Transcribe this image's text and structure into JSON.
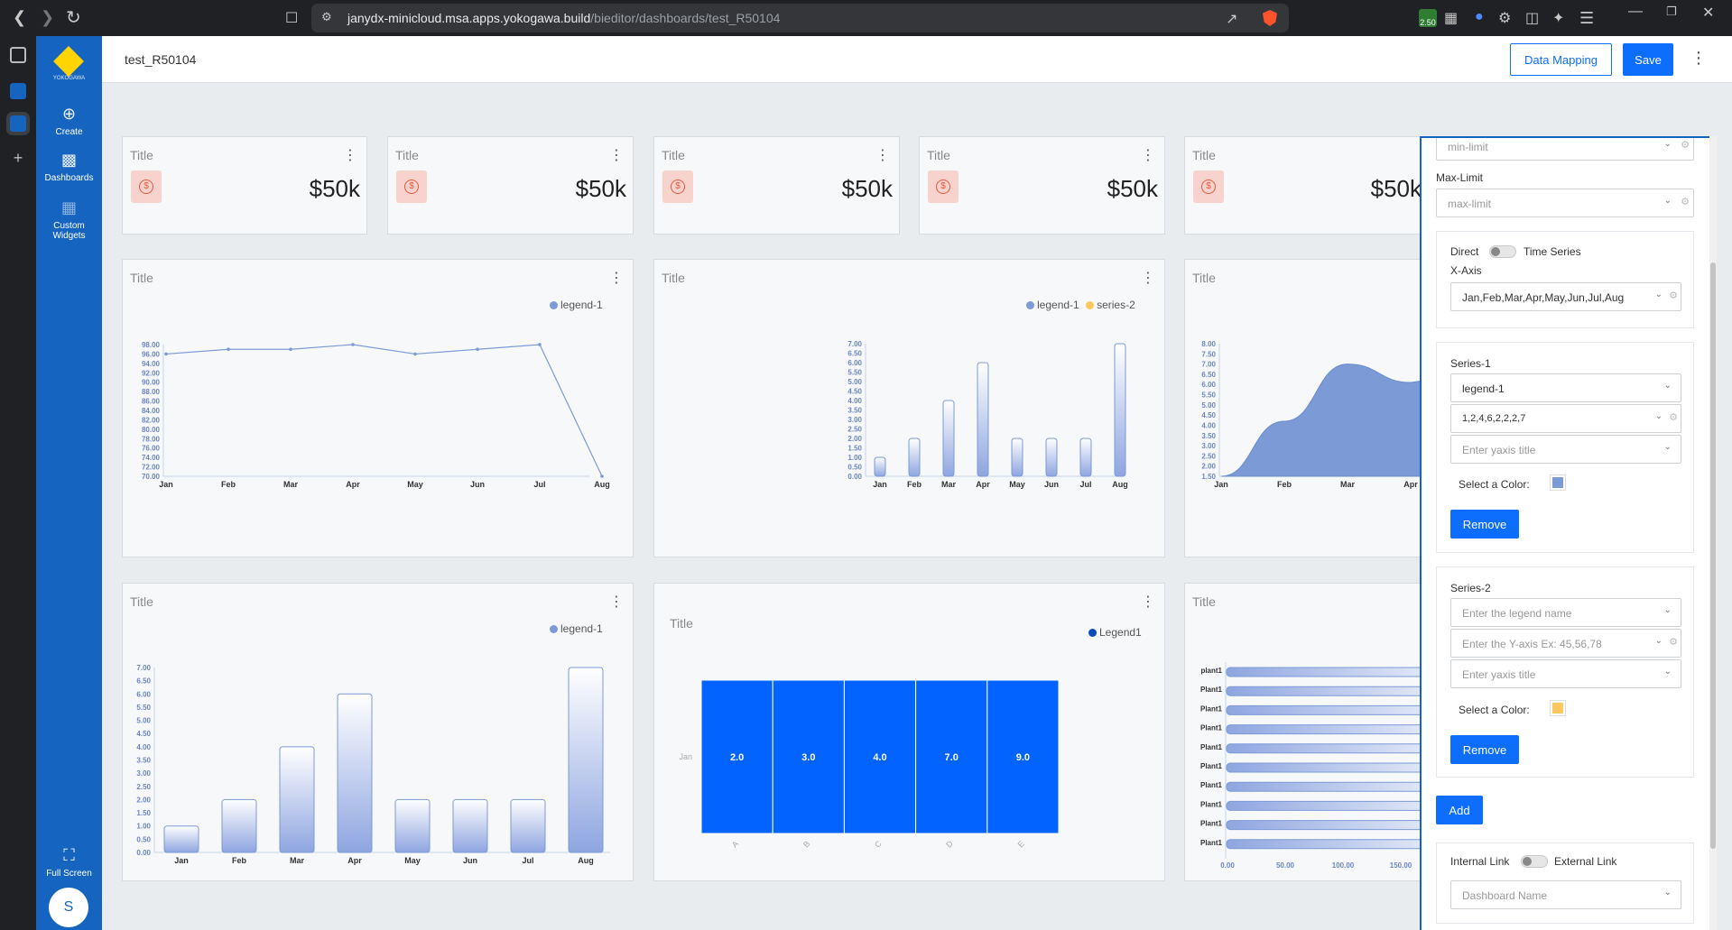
{
  "browser": {
    "url_host": "janydx-minicloud.msa.apps.yokogawa.build",
    "url_path": "/bieditor/dashboards/test_R50104",
    "ext_badge": "2.50"
  },
  "app": {
    "logo_text": "YOKOGAWA",
    "nav": [
      {
        "label": "Create",
        "icon": "plus-circle-icon"
      },
      {
        "label": "Dashboards",
        "icon": "bar-chart-icon"
      },
      {
        "label": "Custom Widgets",
        "icon": "grid-icon"
      }
    ],
    "fullscreen_label": "Full Screen",
    "avatar": "S"
  },
  "header": {
    "title": "test_R50104",
    "data_mapping_label": "Data Mapping",
    "save_label": "Save"
  },
  "kpis": [
    {
      "title": "Title",
      "value": "$50k"
    },
    {
      "title": "Title",
      "value": "$50k"
    },
    {
      "title": "Title",
      "value": "$50k"
    },
    {
      "title": "Title",
      "value": "$50k"
    },
    {
      "title": "Title",
      "value": "$50k"
    }
  ],
  "colors": {
    "accent": "#0d6efd",
    "sidebar": "#1565c0",
    "series1": "#7b9ad6",
    "series2": "#fdc85f",
    "heat": "#0263ff",
    "kpi_icon": "#e05a3f"
  },
  "charts": {
    "line": {
      "title": "Title",
      "legend": "legend-1",
      "chart_data": {
        "type": "line",
        "categories": [
          "Jan",
          "Feb",
          "Mar",
          "Apr",
          "May",
          "Jun",
          "Jul",
          "Aug"
        ],
        "series": [
          {
            "name": "legend-1",
            "values": [
              96,
              97,
              97,
              98,
              96,
              97,
              98,
              70
            ]
          }
        ],
        "ylim": [
          70,
          98
        ],
        "yticks": [
          "70.00",
          "72.00",
          "74.00",
          "76.00",
          "78.00",
          "80.00",
          "82.00",
          "84.00",
          "86.00",
          "88.00",
          "90.00",
          "92.00",
          "94.00",
          "96.00",
          "98.00"
        ]
      }
    },
    "bar": {
      "title": "Title",
      "legend1": "legend-1",
      "legend2": "series-2",
      "chart_data": {
        "type": "bar",
        "categories": [
          "Jan",
          "Feb",
          "Mar",
          "Apr",
          "May",
          "Jun",
          "Jul",
          "Aug"
        ],
        "series": [
          {
            "name": "legend-1",
            "values": [
              1,
              2,
              4,
              6,
              2,
              2,
              2,
              7
            ]
          }
        ],
        "ylim": [
          0,
          7
        ],
        "yticks": [
          "0.00",
          "0.50",
          "1.00",
          "1.50",
          "2.00",
          "2.50",
          "3.00",
          "3.50",
          "4.00",
          "4.50",
          "5.00",
          "5.50",
          "6.00",
          "6.50",
          "7.00"
        ]
      }
    },
    "area": {
      "title": "Title",
      "chart_data": {
        "type": "area",
        "categories": [
          "Jan",
          "Feb",
          "Mar",
          "Apr"
        ],
        "values": [
          1.5,
          4.2,
          7.0,
          6.1
        ],
        "ylim": [
          1.5,
          8
        ],
        "yticks": [
          "1.50",
          "2.00",
          "2.50",
          "3.00",
          "3.50",
          "4.00",
          "4.50",
          "5.00",
          "5.50",
          "6.00",
          "6.50",
          "7.00",
          "7.50",
          "8.00"
        ],
        "xticks": [
          "Jan",
          "Feb",
          "Mar",
          "Apr"
        ]
      }
    },
    "bar2": {
      "title": "Title",
      "legend": "legend-1",
      "chart_data": {
        "type": "bar",
        "categories": [
          "Jan",
          "Feb",
          "Mar",
          "Apr",
          "May",
          "Jun",
          "Jul",
          "Aug"
        ],
        "series": [
          {
            "name": "legend-1",
            "values": [
              1,
              2,
              4,
              6,
              2,
              2,
              2,
              7
            ]
          }
        ],
        "ylim": [
          0,
          7
        ],
        "yticks": [
          "0.00",
          "0.50",
          "1.00",
          "1.50",
          "2.00",
          "2.50",
          "3.00",
          "3.50",
          "4.00",
          "4.50",
          "5.00",
          "5.50",
          "6.00",
          "6.50",
          "7.00"
        ]
      }
    },
    "heatmap": {
      "title": "Title",
      "legend": "Legend1",
      "chart_data": {
        "type": "heatmap",
        "rows": [
          "Jan"
        ],
        "columns": [
          "A",
          "B",
          "C",
          "D",
          "E"
        ],
        "values": [
          [
            2.0,
            3.0,
            4.0,
            7.0,
            9.0
          ]
        ],
        "labels": [
          "2.0",
          "3.0",
          "4.0",
          "7.0",
          "9.0"
        ]
      }
    },
    "hbar": {
      "title": "Title",
      "chart_data": {
        "type": "bar",
        "orientation": "horizontal",
        "categories": [
          "plant1",
          "Plant1",
          "Plant1",
          "Plant1",
          "Plant1",
          "Plant1",
          "Plant1",
          "Plant1",
          "Plant1",
          "Plant1"
        ],
        "xticks": [
          "0.00",
          "50.00",
          "100.00",
          "150.00"
        ],
        "xlim": [
          0,
          150
        ]
      }
    }
  },
  "panel": {
    "min_limit_placeholder": "min-limit",
    "max_limit_label": "Max-Limit",
    "max_limit_placeholder": "max-limit",
    "direct_label": "Direct",
    "timeseries_label": "Time Series",
    "xaxis_label": "X-Axis",
    "xaxis_value": "Jan,Feb,Mar,Apr,May,Jun,Jul,Aug",
    "series1": {
      "label": "Series-1",
      "legend_value": "legend-1",
      "y_value": "1,2,4,6,2,2,2,7",
      "yaxis_placeholder": "Enter yaxis title",
      "color_label": "Select a Color:",
      "remove_label": "Remove"
    },
    "series2": {
      "label": "Series-2",
      "legend_placeholder": "Enter the legend name",
      "y_placeholder": "Enter the Y-axis Ex: 45,56,78",
      "yaxis_placeholder": "Enter yaxis title",
      "color_label": "Select a Color:",
      "remove_label": "Remove"
    },
    "add_label": "Add",
    "internal_link_label": "Internal Link",
    "external_link_label": "External Link",
    "dashboard_placeholder": "Dashboard Name"
  }
}
